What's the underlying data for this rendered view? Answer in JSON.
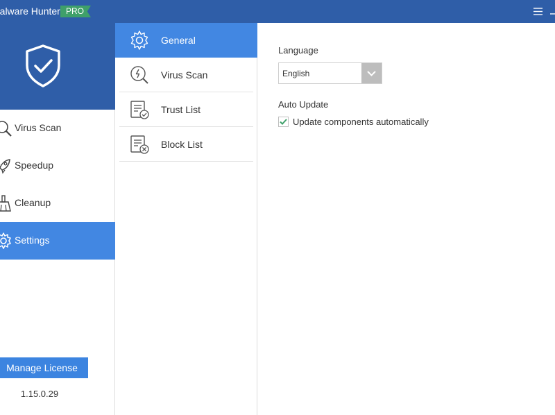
{
  "titlebar": {
    "app_title": "Malware Hunter",
    "badge": "PRO"
  },
  "sidebar": {
    "items": [
      {
        "label": "Virus Scan",
        "icon": "magnifier-icon",
        "active": false
      },
      {
        "label": "Speedup",
        "icon": "rocket-icon",
        "active": false
      },
      {
        "label": "Cleanup",
        "icon": "broom-icon",
        "active": false
      },
      {
        "label": "Settings",
        "icon": "gear-icon",
        "active": true
      }
    ],
    "license_button": "Manage License",
    "version": "1.15.0.29"
  },
  "settings_menu": {
    "items": [
      {
        "label": "General",
        "icon": "gear-icon",
        "active": true
      },
      {
        "label": "Virus Scan",
        "icon": "scan-icon",
        "active": false
      },
      {
        "label": "Trust List",
        "icon": "trust-list-icon",
        "active": false
      },
      {
        "label": "Block List",
        "icon": "block-list-icon",
        "active": false
      }
    ]
  },
  "general": {
    "language_label": "Language",
    "language_value": "English",
    "auto_update_label": "Auto Update",
    "auto_update_option": "Update components automatically",
    "auto_update_checked": true
  },
  "colors": {
    "titlebar": "#2f5ea8",
    "accent": "#4287e2",
    "badge": "#3fa06a",
    "check": "#3fa06a"
  }
}
